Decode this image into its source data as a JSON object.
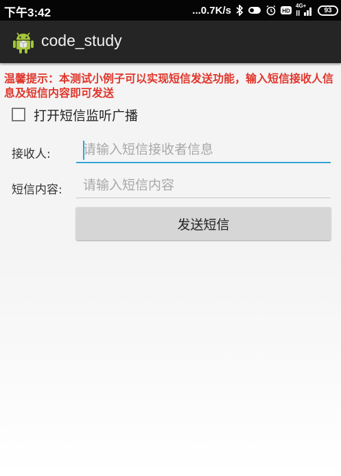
{
  "status_bar": {
    "time": "下午3:42",
    "network_speed": "...0.7K/s",
    "network_type": "4G+",
    "battery": "93",
    "icons": [
      "bluetooth-icon",
      "toggle-icon",
      "alarm-icon",
      "hd-icon",
      "signal-icon",
      "battery-icon"
    ]
  },
  "app_bar": {
    "title": "code_study",
    "icon": "android-icon"
  },
  "tip": "温馨提示：本测试小例子可以实现短信发送功能，输入短信接收人信息及短信内容即可发送",
  "checkbox": {
    "label": "打开短信监听广播",
    "checked": false
  },
  "recipient": {
    "label": "接收人:",
    "placeholder": "请输入短信接收者信息",
    "value": ""
  },
  "content": {
    "label": "短信内容:",
    "placeholder": "请输入短信内容",
    "value": ""
  },
  "send_button": "发送短信",
  "colors": {
    "status_bar_bg": "#050505",
    "app_bar_bg": "#252525",
    "tip_text": "#e0362b",
    "focus_accent": "#34a3d8",
    "button_bg": "#d6d6d6"
  }
}
